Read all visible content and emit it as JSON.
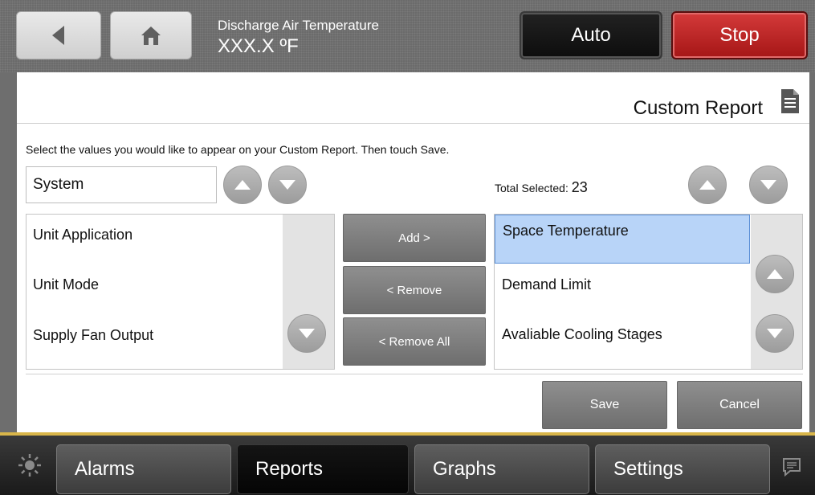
{
  "header": {
    "label": "Discharge Air Temperature",
    "value": "XXX.X ºF",
    "auto_label": "Auto",
    "stop_label": "Stop",
    "back_icon": "back-arrow-icon",
    "home_icon": "home-icon"
  },
  "panel": {
    "title": "Custom Report",
    "title_icon": "document-icon",
    "instructions": "Select the values you would like to appear on your Custom Report. Then touch Save.",
    "category": "System",
    "total_label": "Total Selected: ",
    "total_value": "23",
    "available": [
      "Unit Application",
      "Unit Mode",
      "Supply Fan Output"
    ],
    "selected": [
      "Space Temperature",
      "Demand Limit",
      "Avaliable Cooling Stages"
    ],
    "add_label": "Add >",
    "remove_label": "< Remove",
    "remove_all_label": "< Remove All",
    "save_label": "Save",
    "cancel_label": "Cancel"
  },
  "nav": {
    "tabs": [
      "Alarms",
      "Reports",
      "Graphs",
      "Settings"
    ],
    "active": "Reports",
    "brightness_icon": "sun-icon",
    "messages_icon": "chat-icon"
  },
  "colors": {
    "stop": "#b51f1f",
    "selection": "#b8d4f8",
    "accent_bar": "#d9b64a"
  }
}
